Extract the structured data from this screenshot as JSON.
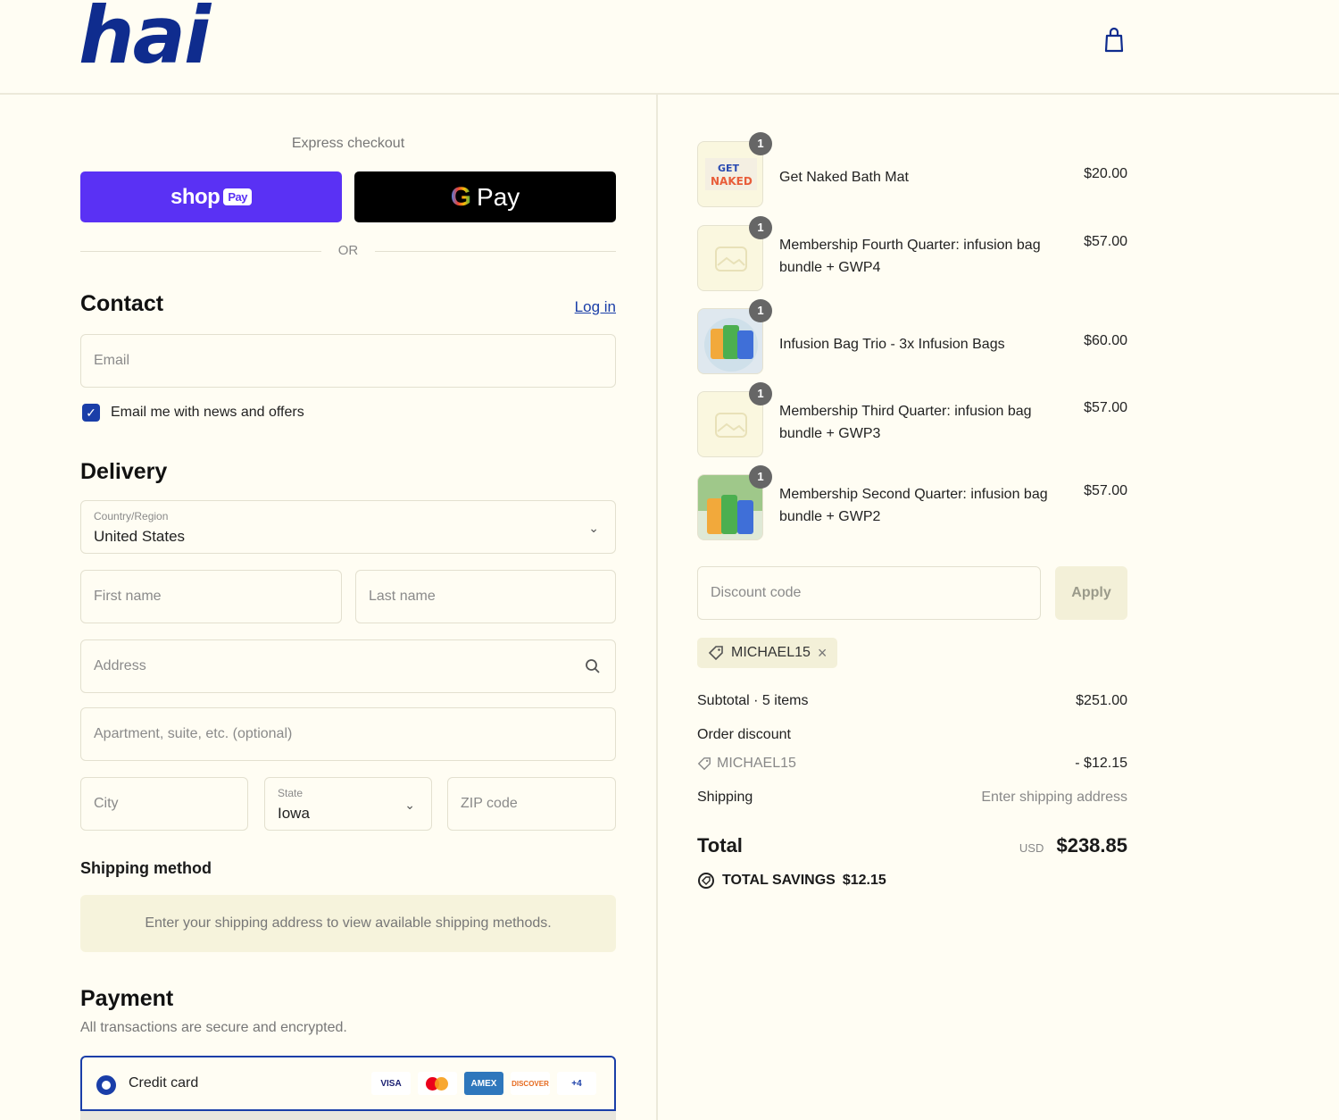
{
  "header": {
    "logo": "hai",
    "cart_icon": "shopping-bag-icon"
  },
  "express": {
    "label": "Express checkout",
    "shop_text": "shop",
    "shop_badge": "Pay",
    "gpay_g": "G",
    "gpay_text": "Pay",
    "or_text": "OR"
  },
  "contact": {
    "title": "Contact",
    "login": "Log in",
    "email_placeholder": "Email",
    "newsletter_label": "Email me with news and offers",
    "newsletter_checked": true
  },
  "delivery": {
    "title": "Delivery",
    "country_label": "Country/Region",
    "country_value": "United States",
    "first_name_ph": "First name",
    "last_name_ph": "Last name",
    "address_ph": "Address",
    "apt_ph": "Apartment, suite, etc. (optional)",
    "city_ph": "City",
    "state_label": "State",
    "state_value": "Iowa",
    "zip_ph": "ZIP code"
  },
  "shipping_method": {
    "title": "Shipping method",
    "message": "Enter your shipping address to view available shipping methods."
  },
  "payment": {
    "title": "Payment",
    "subtitle": "All transactions are secure and encrypted.",
    "method_label": "Credit card",
    "card_brands": [
      "VISA",
      "mastercard",
      "AMEX",
      "DISCOVER",
      "+4"
    ]
  },
  "order": {
    "items": [
      {
        "qty": "1",
        "name": "Get Naked Bath Mat",
        "price": "$20.00"
      },
      {
        "qty": "1",
        "name": "Membership Fourth Quarter: infusion bag bundle + GWP4",
        "price": "$57.00"
      },
      {
        "qty": "1",
        "name": "Infusion Bag Trio - 3x Infusion Bags",
        "price": "$60.00"
      },
      {
        "qty": "1",
        "name": "Membership Third Quarter: infusion bag bundle + GWP3",
        "price": "$57.00"
      },
      {
        "qty": "1",
        "name": "Membership Second Quarter: infusion bag bundle + GWP2",
        "price": "$57.00"
      }
    ],
    "discount_ph": "Discount code",
    "apply": "Apply",
    "applied_code": "MICHAEL15",
    "subtotal_label": "Subtotal · 5 items",
    "subtotal_value": "$251.00",
    "order_discount_label": "Order discount",
    "discount_code_line": "MICHAEL15",
    "discount_value": "- $12.15",
    "shipping_label": "Shipping",
    "shipping_value": "Enter shipping address",
    "total_label": "Total",
    "currency": "USD",
    "total_value": "$238.85",
    "savings_label": "TOTAL SAVINGS",
    "savings_value": "$12.15"
  },
  "colors": {
    "brand_blue": "#0f2c8e",
    "shop_purple": "#5a31f4",
    "background": "#fffdf3"
  }
}
